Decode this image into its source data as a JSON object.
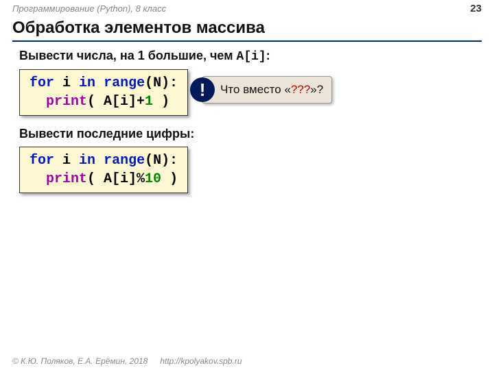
{
  "header": {
    "course": "Программирование (Python), 8 класс",
    "page": "23"
  },
  "title": "Обработка элементов массива",
  "subtitle1_pre": "Вывести числа, на 1 большие, чем ",
  "subtitle1_code": "A[i]",
  "subtitle1_post": ":",
  "code1": {
    "for": "for",
    "i": " i ",
    "in": "in",
    "sp": " ",
    "range": "range",
    "args1": "(N):",
    "indent": "  ",
    "print": "print",
    "open": "( A[i]+",
    "num": "1",
    "close": " )"
  },
  "callout": {
    "mark": "!",
    "pre": "Что вместо «",
    "q": "???",
    "post": "»?"
  },
  "subtitle2": "Вывести последние цифры:",
  "code2": {
    "for": "for",
    "i": " i ",
    "in": "in",
    "sp": " ",
    "range": "range",
    "args1": "(N):",
    "indent": "  ",
    "print": "print",
    "open": "( A[i]%",
    "num": "10",
    "close": " )"
  },
  "footer": {
    "copyright": "© К.Ю. Поляков, Е.А. Ерёмин, 2018",
    "url": "http://kpolyakov.spb.ru"
  }
}
